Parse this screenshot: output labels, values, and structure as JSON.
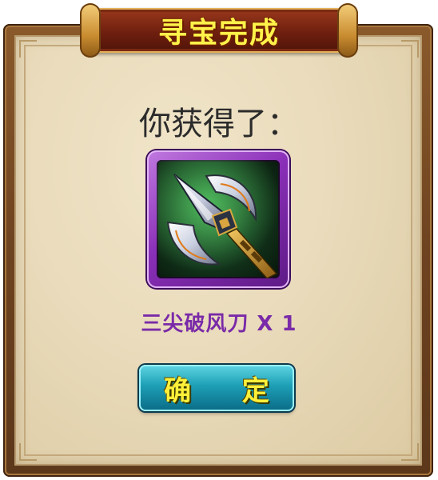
{
  "dialog": {
    "title": "寻宝完成",
    "prompt": "你获得了：",
    "reward": {
      "icon": "three-pointed-glaive-icon",
      "name": "三尖破风刀 X 1",
      "rarity_color": "#8a2fb8"
    },
    "confirm_label": "确 定"
  },
  "colors": {
    "title_text": "#fff24a",
    "item_name": "#7a2aa8",
    "button": "#1d9fb5",
    "button_text": "#fff03a",
    "parchment": "#e9dbbb",
    "frame_wood": "#6e4320"
  }
}
